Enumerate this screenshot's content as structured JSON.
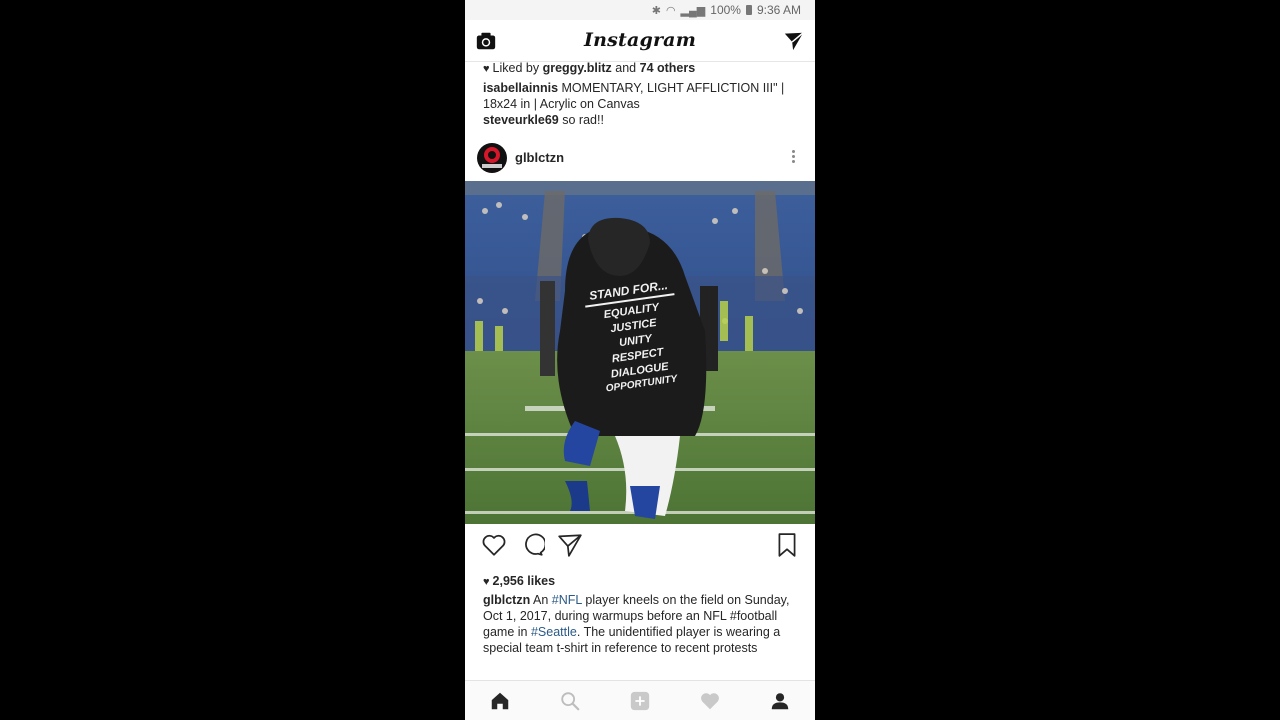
{
  "status_bar": {
    "battery": "100%",
    "time": "9:36 AM"
  },
  "header": {
    "logo": "Instagram",
    "left_icon": "camera-icon",
    "right_icon": "direct-message-icon"
  },
  "previous_post": {
    "liked_prefix": "Liked by",
    "liked_user": "greggy.blitz",
    "liked_and": "and",
    "liked_others": "74 others",
    "caption_user": "isabellainnis",
    "caption_text": "MOMENTARY, LIGHT AFFLICTION III\" | 18x24 in | Acrylic on Canvas",
    "comment_user": "steveurkle69",
    "comment_text": "so rad!!"
  },
  "post": {
    "username": "glblctzn",
    "likes": "2,956 likes",
    "caption": {
      "user": "glblctzn",
      "t1": "An",
      "tag1": "#NFL",
      "t2": "player kneels on the field on Sunday, Oct 1, 2017, during warmups before an NFL #football game in",
      "tag2": "#Seattle",
      "t3": ". The unidentified player is wearing a special team t-shirt in reference to recent protests"
    },
    "shirt_text": {
      "heading": "STAND FOR...",
      "lines": [
        "EQUALITY",
        "JUSTICE",
        "UNITY",
        "RESPECT",
        "DIALOGUE",
        "OPPORTUNITY"
      ]
    }
  },
  "actions": [
    "heart-icon",
    "comment-icon",
    "share-icon",
    "bookmark-icon"
  ],
  "bottom_nav": [
    "home-icon",
    "search-icon",
    "add-post-icon",
    "activity-heart-icon",
    "profile-icon"
  ]
}
